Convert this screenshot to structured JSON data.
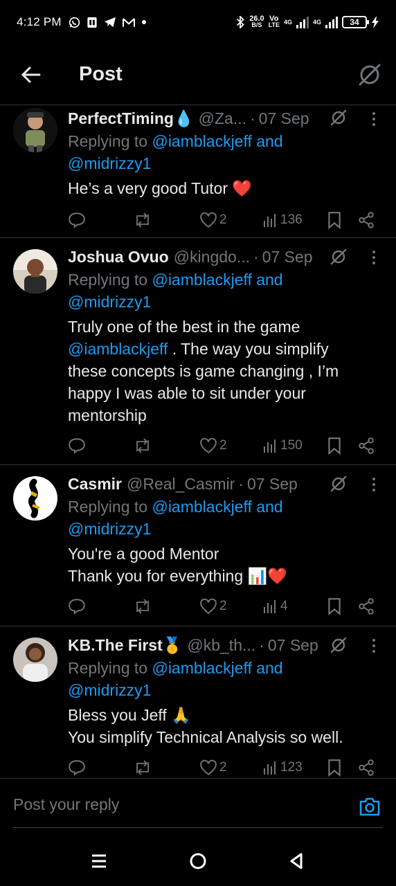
{
  "status_bar": {
    "time": "4:12 PM",
    "left_icons": [
      "whatsapp-icon",
      "sim-icon",
      "telegram-icon",
      "gmail-icon",
      "dot-icon"
    ],
    "speed_value": "26.0",
    "speed_unit": "B/S",
    "volte_top": "Vo",
    "volte_bottom": "LTE",
    "network_1": "4G",
    "network_2": "4G",
    "battery": "34"
  },
  "header": {
    "title": "Post"
  },
  "posts": [
    {
      "name": "PerfectTiming",
      "name_emoji": "💧",
      "handle": "@Za...",
      "dot": "·",
      "date": "07 Sep",
      "reply_prefix": "Replying to",
      "reply_users": "@iamblackjeff and",
      "reply_users_2": "@midrizzy1",
      "body_lines": [
        "He’s a very good Tutor ❤️"
      ],
      "likes": "2",
      "views": "136"
    },
    {
      "name": "Joshua Ovuo",
      "name_emoji": "",
      "handle": "@kingdo...",
      "dot": "·",
      "date": "07 Sep",
      "reply_prefix": "Replying to",
      "reply_users": "@iamblackjeff and",
      "reply_users_2": "@midrizzy1",
      "body_line1": "Truly one of the best in the game",
      "body_mention": "@iamblackjeff",
      "body_line2_rest": " . The way you simplify",
      "body_line3": "these concepts is game changing , I’m",
      "body_line4": "happy I was able to sit under your",
      "body_line5": "mentorship",
      "likes": "2",
      "views": "150"
    },
    {
      "name": "Casmir",
      "name_emoji": "",
      "handle": "@Real_Casmir",
      "dot": "·",
      "date": "07 Sep",
      "reply_prefix": "Replying to",
      "reply_users": "@iamblackjeff and",
      "reply_users_2": "@midrizzy1",
      "body_lines": [
        "You're a good Mentor",
        "Thank you for everything 📊❤️"
      ],
      "likes": "2",
      "views": "4"
    },
    {
      "name": "KB.The First",
      "name_emoji": "🥇",
      "handle": "@kb_th...",
      "dot": "·",
      "date": "07 Sep",
      "reply_prefix": "Replying to",
      "reply_users": "@iamblackjeff and",
      "reply_users_2": "@midrizzy1",
      "body_lines": [
        "Bless you Jeff 🙏",
        "You simplify Technical Analysis so well."
      ],
      "likes": "2",
      "views": "123"
    }
  ],
  "composer": {
    "placeholder": "Post your reply"
  },
  "navbar": {
    "buttons": [
      "recents-icon",
      "home-icon",
      "back-triangle-icon"
    ]
  },
  "colors": {
    "background": "#000000",
    "accent_blue": "#1d9bf0",
    "muted": "#71767b",
    "text": "#e7e9ea",
    "divider": "#2f3336",
    "heart_red": "#e0245e"
  }
}
